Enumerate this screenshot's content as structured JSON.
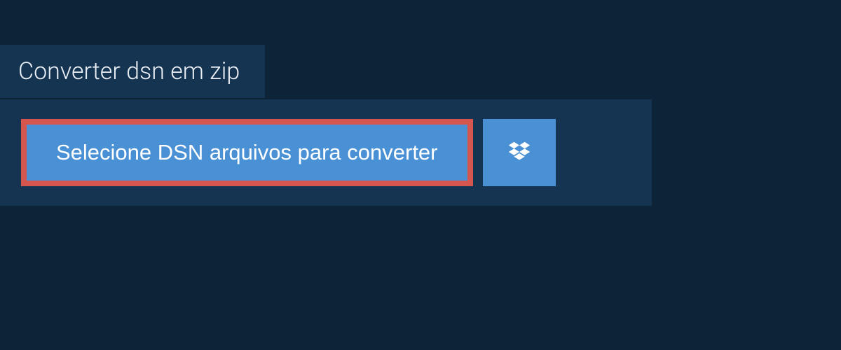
{
  "tab": {
    "label": "Converter dsn em zip"
  },
  "panel": {
    "select_button_label": "Selecione DSN arquivos para converter"
  },
  "colors": {
    "background": "#0d2438",
    "panel": "#153451",
    "button": "#4990d4",
    "highlight_border": "#d5564f",
    "text_light": "#ffffff"
  }
}
